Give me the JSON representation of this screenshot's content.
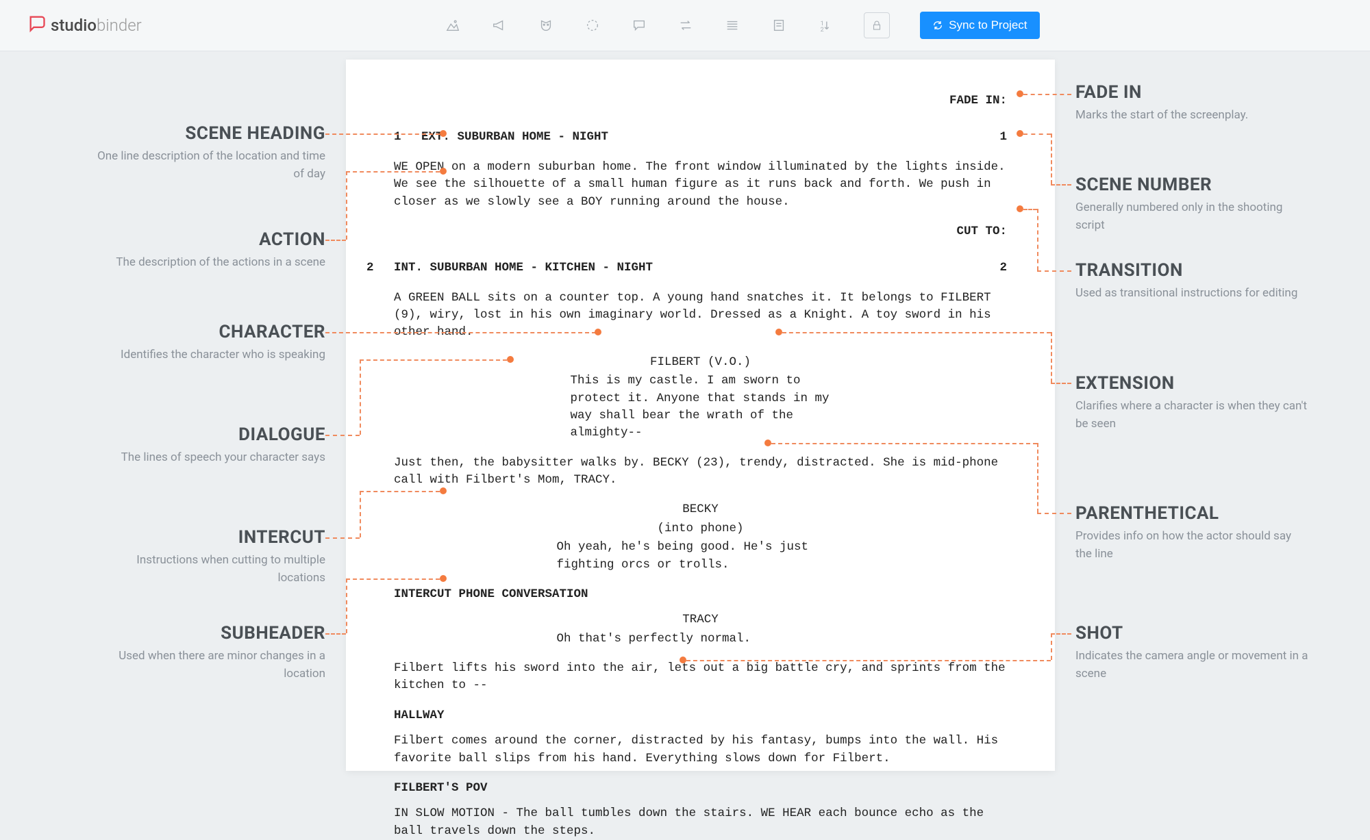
{
  "toolbar": {
    "logo_studio": "studio",
    "logo_binder": "binder",
    "sync_label": "Sync to Project"
  },
  "callouts": {
    "left": [
      {
        "title": "SCENE HEADING",
        "desc": "One line description of the location and time of day"
      },
      {
        "title": "ACTION",
        "desc": "The description of the actions in a scene"
      },
      {
        "title": "CHARACTER",
        "desc": "Identifies the character who is speaking"
      },
      {
        "title": "DIALOGUE",
        "desc": "The lines of speech your character says"
      },
      {
        "title": "INTERCUT",
        "desc": "Instructions when cutting to multiple locations"
      },
      {
        "title": "SUBHEADER",
        "desc": "Used when there are minor changes in a location"
      }
    ],
    "right": [
      {
        "title": "FADE IN",
        "desc": "Marks the start of the screenplay."
      },
      {
        "title": "SCENE NUMBER",
        "desc": "Generally numbered only in the shooting script"
      },
      {
        "title": "TRANSITION",
        "desc": "Used as transitional instructions for editing"
      },
      {
        "title": "EXTENSION",
        "desc": "Clarifies where a character is when they can't be seen"
      },
      {
        "title": "PARENTHETICAL",
        "desc": "Provides info on how the actor should say the line"
      },
      {
        "title": "SHOT",
        "desc": "Indicates the camera angle or movement in a scene"
      }
    ]
  },
  "script": {
    "fade_in": "FADE IN:",
    "scene1_num": "1",
    "scene1_head": "EXT. SUBURBAN HOME - NIGHT",
    "action1": "WE OPEN on a modern suburban home. The front window illuminated by the lights inside. We see the silhouette of a small human figure as it runs back and forth. We push in closer as we slowly see a BOY running around the house.",
    "cut_to": "CUT TO:",
    "scene2_num": "2",
    "scene2_head": "INT. SUBURBAN HOME - KITCHEN - NIGHT",
    "action2": "A GREEN BALL sits on a counter top. A young hand snatches it. It belongs to FILBERT (9), wiry, lost in his own imaginary world. Dressed as a Knight. A toy sword in his other hand.",
    "char_filbert_vo": "FILBERT (V.O.)",
    "dialogue_filbert": "This is my castle. I am sworn to protect it. Anyone that stands in my way shall bear the wrath of the almighty--",
    "action3": "Just then, the babysitter walks by. BECKY (23), trendy, distracted. She is mid-phone call with Filbert's Mom, TRACY.",
    "char_becky": "BECKY",
    "paren_becky": "(into phone)",
    "dialogue_becky": "Oh yeah, he's being good. He's just fighting orcs or trolls.",
    "intercut": "INTERCUT PHONE CONVERSATION",
    "char_tracy": "TRACY",
    "dialogue_tracy": "Oh that's perfectly normal.",
    "action4": "Filbert lifts his sword into the air, lets out a big battle cry, and sprints from the kitchen to --",
    "hallway": "HALLWAY",
    "action5": "Filbert comes around the corner, distracted by his fantasy, bumps into the wall. His favorite ball slips from his hand. Everything slows down for Filbert.",
    "pov": "FILBERT'S POV",
    "action6": "IN SLOW MOTION - The ball tumbles down the stairs. WE HEAR each bounce echo as the ball travels down the steps."
  }
}
